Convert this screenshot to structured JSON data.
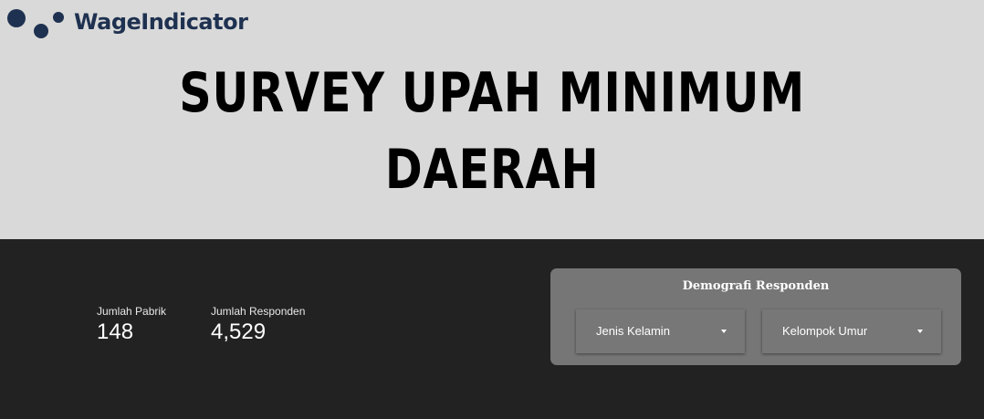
{
  "header": {
    "logo_text": "WageIndicator",
    "title_line1": "SURVEY UPAH MINIMUM",
    "title_line2": "DAERAH"
  },
  "stats": {
    "pabrik": {
      "label": "Jumlah Pabrik",
      "value": "148"
    },
    "responden": {
      "label": "Jumlah Responden",
      "value": "4,529"
    }
  },
  "demografi": {
    "title": "Demografi Responden",
    "filters": [
      {
        "label": "Jenis Kelamin",
        "icon": "chevron-down-icon"
      },
      {
        "label": "Kelompok Umur",
        "icon": "chevron-down-icon"
      }
    ]
  },
  "colors": {
    "banner_bg": "#d9d9d9",
    "page_bg": "#222222",
    "panel_bg": "#767676",
    "brand": "#1e3150"
  }
}
